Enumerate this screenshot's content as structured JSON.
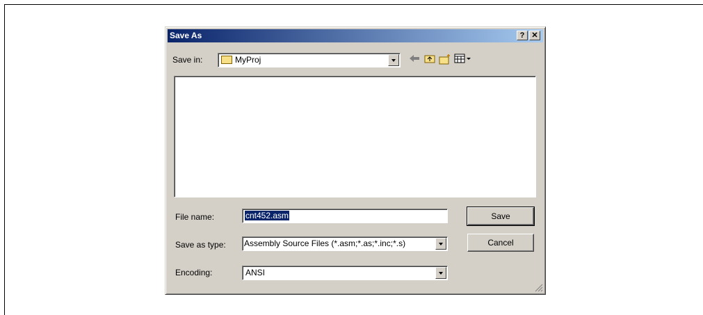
{
  "dialog": {
    "title": "Save As",
    "help_label": "?",
    "close_label": "✕",
    "save_in_label": "Save in:",
    "save_in_value": "MyProj",
    "file_name_label": "File name:",
    "file_name_value": "cnt452.asm",
    "save_as_type_label": "Save as type:",
    "save_as_type_value": "Assembly Source Files (*.asm;*.as;*.inc;*.s)",
    "encoding_label": "Encoding:",
    "encoding_value": "ANSI",
    "save_button": "Save",
    "cancel_button": "Cancel"
  },
  "toolbar": {
    "back_icon": "back-arrow-icon",
    "up_icon": "up-folder-icon",
    "new_folder_icon": "new-folder-icon",
    "view_icon": "view-menu-icon"
  },
  "colors": {
    "title_bar_start": "#0a246a",
    "title_bar_end": "#a6caf0",
    "dialog_bg": "#d4d0c8",
    "selection": "#0a246a"
  }
}
